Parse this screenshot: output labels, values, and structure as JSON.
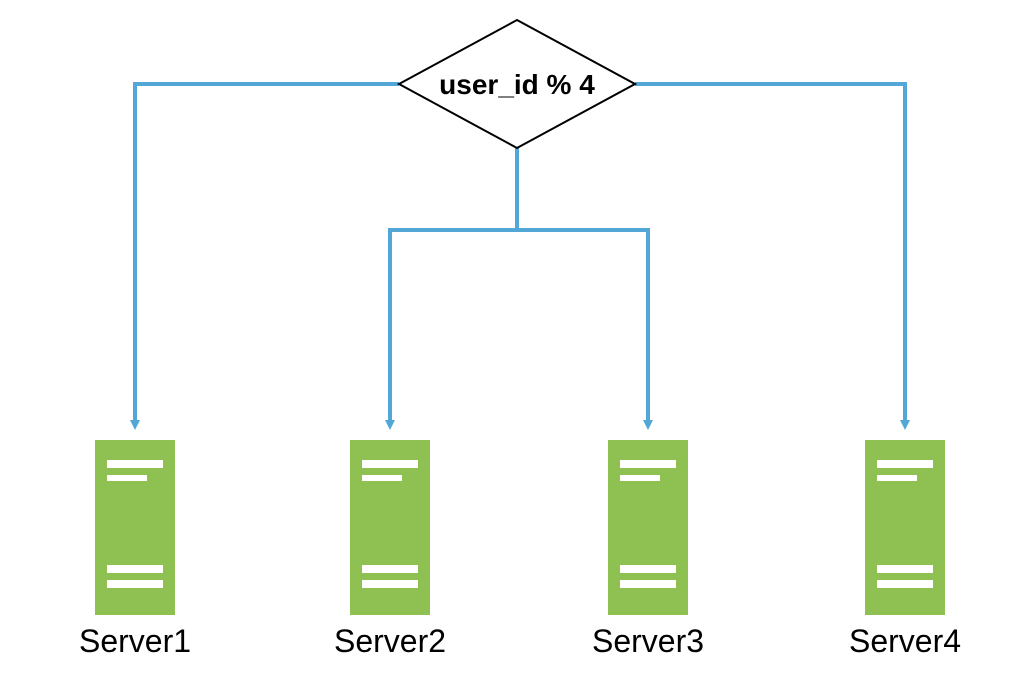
{
  "diagram": {
    "decision": {
      "label": "user_id % 4"
    },
    "servers": [
      {
        "label": "Server1"
      },
      {
        "label": "Server2"
      },
      {
        "label": "Server3"
      },
      {
        "label": "Server4"
      }
    ],
    "colors": {
      "connector": "#52a7d6",
      "server_fill": "#8ec152",
      "server_slot": "#ffffff",
      "decision_stroke": "#000000",
      "decision_fill": "#ffffff"
    }
  }
}
